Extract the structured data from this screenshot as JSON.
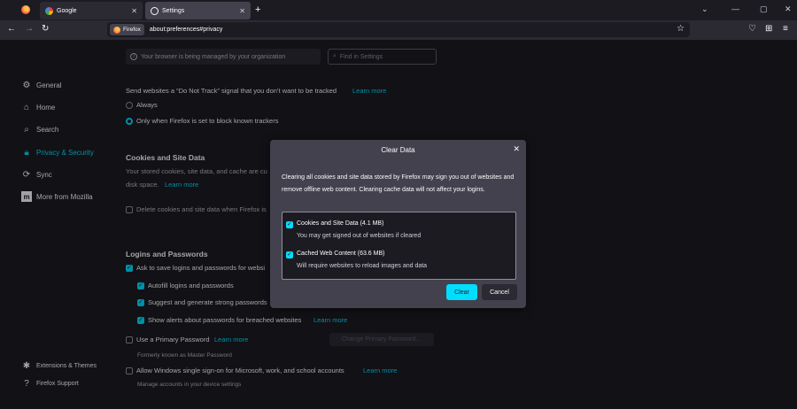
{
  "browser": {
    "tabs": [
      {
        "label": "Google"
      },
      {
        "label": "Settings"
      }
    ],
    "url_identity": "Firefox",
    "url": "about:preferences#privacy",
    "new_tab_symbol": "+"
  },
  "icons": {
    "back": "arrow-left-icon",
    "forward": "arrow-right-icon",
    "reload": "reload-icon",
    "star": "star-icon",
    "close": "close-icon"
  },
  "managed_notice": "Your browser is being managed by your organization",
  "search": {
    "placeholder": "Find in Settings"
  },
  "sidebar": {
    "items": [
      {
        "label": "General",
        "icon": "gear-icon"
      },
      {
        "label": "Home",
        "icon": "home-icon"
      },
      {
        "label": "Search",
        "icon": "search-icon"
      },
      {
        "label": "Privacy & Security",
        "icon": "lock-icon"
      },
      {
        "label": "Sync",
        "icon": "sync-icon"
      },
      {
        "label": "More from Mozilla",
        "icon": "mozilla-icon"
      }
    ],
    "footer": [
      {
        "label": "Extensions & Themes",
        "icon": "puzzle-icon"
      },
      {
        "label": "Firefox Support",
        "icon": "help-icon"
      }
    ]
  },
  "dnt": {
    "text": "Send websites a “Do Not Track” signal that you don’t want to be tracked",
    "learn_more": "Learn more",
    "option_always": "Always",
    "option_only_when": "Only when Firefox is set to block known trackers"
  },
  "cookies": {
    "heading": "Cookies and Site Data",
    "desc_line1": "Your stored cookies, site data, and cache are cu",
    "desc_line2": "disk space.",
    "learn_more": "Learn more",
    "delete_on_close": "Delete cookies and site data when Firefox is"
  },
  "logins": {
    "heading": "Logins and Passwords",
    "ask_save": "Ask to save logins and passwords for websi",
    "autofill": "Autofill logins and passwords",
    "suggest": "Suggest and generate strong passwords",
    "breach_alerts": "Show alerts about passwords for breached websites",
    "breach_learn_more": "Learn more",
    "primary_password": "Use a Primary Password",
    "primary_learn_more": "Learn more",
    "change_primary_button": "Change Primary Password…",
    "formerly": "Formerly known as Master Password",
    "windows_sso": "Allow Windows single sign-on for Microsoft, work, and school accounts",
    "windows_learn_more": "Learn more",
    "manage_accounts": "Manage accounts in your device settings"
  },
  "dialog": {
    "title": "Clear Data",
    "desc": "Clearing all cookies and site data stored by Firefox may sign you out of websites and remove offline web content. Clearing cache data will not affect your logins.",
    "options": [
      {
        "label": "Cookies and Site Data (4.1 MB)",
        "sub": "You may get signed out of websites if cleared",
        "checked": true
      },
      {
        "label": "Cached Web Content (63.6 MB)",
        "sub": "Will require websites to reload images and data",
        "checked": true
      }
    ],
    "clear_button": "Clear",
    "cancel_button": "Cancel"
  },
  "colors": {
    "accent": "#00ddff",
    "background": "#1c1b22",
    "dialog": "#42414d"
  }
}
